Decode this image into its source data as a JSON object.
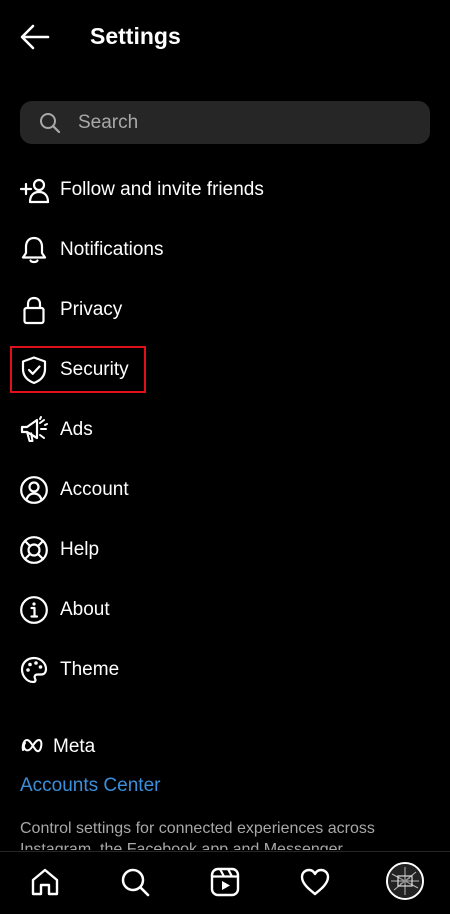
{
  "header": {
    "title": "Settings",
    "back_icon": "arrow-left-icon"
  },
  "search": {
    "placeholder": "Search",
    "value": "",
    "icon": "search-icon"
  },
  "menu": {
    "items": [
      {
        "label": "Follow and invite friends",
        "icon": "add-person-icon"
      },
      {
        "label": "Notifications",
        "icon": "bell-icon"
      },
      {
        "label": "Privacy",
        "icon": "lock-icon"
      },
      {
        "label": "Security",
        "icon": "shield-check-icon",
        "highlighted": true
      },
      {
        "label": "Ads",
        "icon": "megaphone-icon"
      },
      {
        "label": "Account",
        "icon": "user-circle-icon"
      },
      {
        "label": "Help",
        "icon": "lifebuoy-icon"
      },
      {
        "label": "About",
        "icon": "info-icon"
      },
      {
        "label": "Theme",
        "icon": "palette-icon"
      }
    ]
  },
  "meta": {
    "brand": "Meta",
    "link": "Accounts Center",
    "description": "Control settings for connected experiences across Instagram, the Facebook app and Messenger"
  },
  "nav": {
    "items": [
      "home-icon",
      "search-icon",
      "reels-icon",
      "heart-icon",
      "profile-avatar"
    ]
  },
  "colors": {
    "background": "#000000",
    "text": "#ffffff",
    "search_bg": "#262626",
    "link": "#3b8fdb",
    "muted": "#a8a8a8",
    "highlight_border": "#e0101a"
  }
}
